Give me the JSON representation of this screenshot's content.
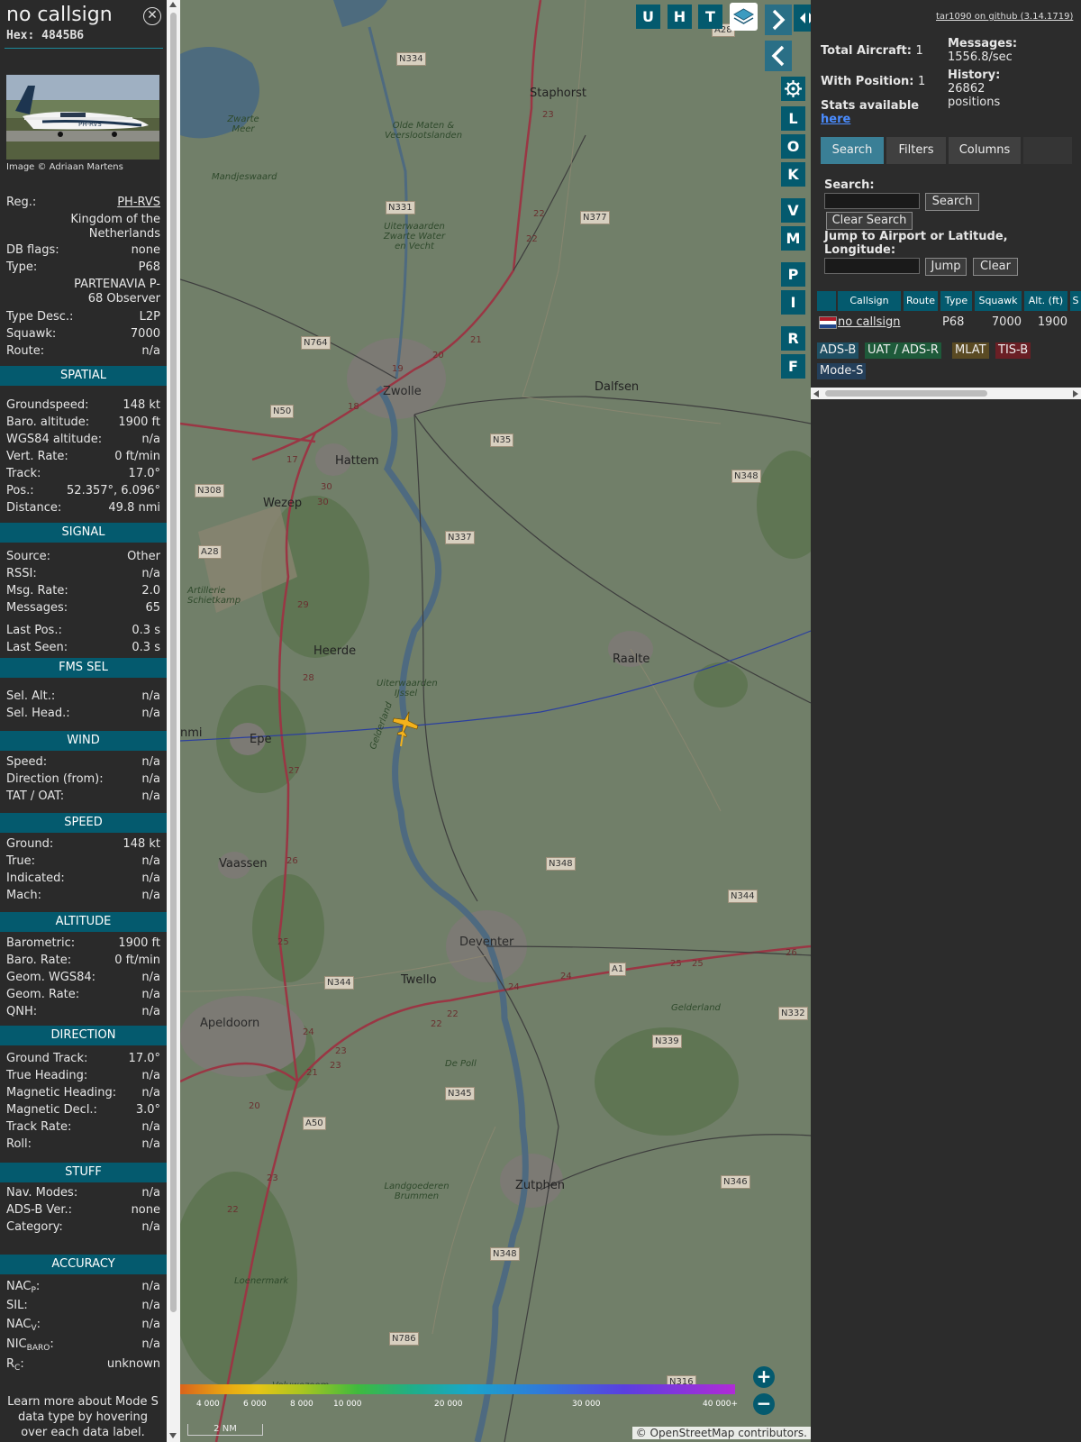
{
  "info": {
    "callsign": "no callsign",
    "hex": "Hex: 4845B6",
    "image_credit": "Image © Adriaan Martens",
    "photo_text": "PH-RVS",
    "details": [
      {
        "k": "Reg.:",
        "v": "PH-RVS"
      },
      {
        "k": "",
        "v": "Kingdom of the Netherlands"
      },
      {
        "k": "DB flags:",
        "v": "none"
      },
      {
        "k": "Type:",
        "v": "P68"
      },
      {
        "k": "",
        "v": "PARTENAVIA P-68 Observer"
      },
      {
        "k": "Type Desc.:",
        "v": "L2P"
      },
      {
        "k": "Squawk:",
        "v": "7000"
      },
      {
        "k": "Route:",
        "v": "n/a"
      }
    ],
    "sections": [
      {
        "title": "SPATIAL",
        "rows": [
          {
            "k": "Groundspeed:",
            "v": "148 kt"
          },
          {
            "k": "Baro. altitude:",
            "v": "1900 ft"
          },
          {
            "k": "WGS84 altitude:",
            "v": "n/a"
          },
          {
            "k": "Vert. Rate:",
            "v": "0 ft/min"
          },
          {
            "k": "Track:",
            "v": "17.0°"
          },
          {
            "k": "Pos.:",
            "v": "52.357°, 6.096°"
          },
          {
            "k": "Distance:",
            "v": "49.8 nmi"
          }
        ]
      },
      {
        "title": "SIGNAL",
        "rows": [
          {
            "k": "Source:",
            "v": "Other"
          },
          {
            "k": "RSSI:",
            "v": "n/a"
          },
          {
            "k": "Msg. Rate:",
            "v": "2.0"
          },
          {
            "k": "Messages:",
            "v": "65"
          },
          {
            "k": "Last Pos.:",
            "v": "0.3 s"
          },
          {
            "k": "Last Seen:",
            "v": "0.3 s"
          }
        ]
      },
      {
        "title": "FMS SEL",
        "rows": [
          {
            "k": "Sel. Alt.:",
            "v": "n/a"
          },
          {
            "k": "Sel. Head.:",
            "v": "n/a"
          }
        ]
      },
      {
        "title": "WIND",
        "rows": [
          {
            "k": "Speed:",
            "v": "n/a"
          },
          {
            "k": "Direction (from):",
            "v": "n/a"
          },
          {
            "k": "TAT / OAT:",
            "v": "n/a"
          }
        ]
      },
      {
        "title": "SPEED",
        "rows": [
          {
            "k": "Ground:",
            "v": "148 kt"
          },
          {
            "k": "True:",
            "v": "n/a"
          },
          {
            "k": "Indicated:",
            "v": "n/a"
          },
          {
            "k": "Mach:",
            "v": "n/a"
          }
        ]
      },
      {
        "title": "ALTITUDE",
        "rows": [
          {
            "k": "Barometric:",
            "v": "1900 ft"
          },
          {
            "k": "Baro. Rate:",
            "v": "0 ft/min"
          },
          {
            "k": "Geom. WGS84:",
            "v": "n/a"
          },
          {
            "k": "Geom. Rate:",
            "v": "n/a"
          },
          {
            "k": "QNH:",
            "v": "n/a"
          }
        ]
      },
      {
        "title": "DIRECTION",
        "rows": [
          {
            "k": "Ground Track:",
            "v": "17.0°"
          },
          {
            "k": "True Heading:",
            "v": "n/a"
          },
          {
            "k": "Magnetic Heading:",
            "v": "n/a"
          },
          {
            "k": "Magnetic Decl.:",
            "v": "3.0°"
          },
          {
            "k": "Track Rate:",
            "v": "n/a"
          },
          {
            "k": "Roll:",
            "v": "n/a"
          }
        ]
      },
      {
        "title": "STUFF",
        "rows": [
          {
            "k": "Nav. Modes:",
            "v": "n/a"
          },
          {
            "k": "ADS-B Ver.:",
            "v": "none"
          },
          {
            "k": "Category:",
            "v": "n/a"
          }
        ]
      },
      {
        "title": "ACCURACY",
        "rows": [
          {
            "k": "NAC",
            "sub": "P",
            "v": "n/a"
          },
          {
            "k": "SIL:",
            "v": "n/a"
          },
          {
            "k": "NAC",
            "sub": "V",
            "v": "n/a"
          },
          {
            "k": "NIC",
            "sub": "BARO",
            "v": "n/a"
          },
          {
            "k": "R",
            "sub": "C",
            "v": "unknown"
          }
        ]
      }
    ],
    "footer": "Learn more about Mode S data type by hovering over each data label."
  },
  "map": {
    "buttons_top": [
      "U",
      "H",
      "T"
    ],
    "side_buttons": [
      "L",
      "O",
      "K",
      "V",
      "M",
      "P",
      "I",
      "R",
      "F"
    ],
    "places": [
      {
        "name": "Staphorst",
        "cls": "city"
      },
      {
        "name": "Zwolle",
        "cls": "big"
      },
      {
        "name": "Dalfsen",
        "cls": "city"
      },
      {
        "name": "Hattem",
        "cls": "city"
      },
      {
        "name": "Wezep",
        "cls": "city"
      },
      {
        "name": "Heerde",
        "cls": "city"
      },
      {
        "name": "Raalte",
        "cls": "city"
      },
      {
        "name": "Epe",
        "cls": "city"
      },
      {
        "name": "Vaassen",
        "cls": "city"
      },
      {
        "name": "Deventer",
        "cls": "big"
      },
      {
        "name": "Twello",
        "cls": "city"
      },
      {
        "name": "Apeldoorn",
        "cls": "big"
      },
      {
        "name": "Zutphen",
        "cls": "city"
      },
      {
        "name": "Mandjeswaard",
        "cls": "it"
      },
      {
        "name": "Zwarte Meer",
        "cls": "it"
      },
      {
        "name": "Olde Maten & Veerslootslanden",
        "cls": "it"
      },
      {
        "name": "Uiterwaarden Zwarte Water en Vecht",
        "cls": "it"
      },
      {
        "name": "Artillerie Schietkamp",
        "cls": "it"
      },
      {
        "name": "Uiterwaarden IJssel",
        "cls": "it"
      },
      {
        "name": "De Poll",
        "cls": "it"
      },
      {
        "name": "Landgoederen Brummen",
        "cls": "it"
      },
      {
        "name": "Loenermark",
        "cls": "it"
      },
      {
        "name": "Veluwezoom",
        "cls": "it"
      },
      {
        "name": "Gelderland",
        "cls": "it"
      },
      {
        "name": "Gelderland",
        "cls": "it"
      },
      {
        "name": "nmi",
        "cls": "city"
      }
    ],
    "shields": [
      "N334",
      "A28",
      "N331",
      "N377",
      "N764",
      "N50",
      "N35",
      "N348",
      "N308",
      "N337",
      "A28",
      "N348",
      "N344",
      "A1",
      "N332",
      "N344",
      "N339",
      "N345",
      "A50",
      "N346",
      "N348",
      "N786",
      "N316"
    ],
    "road_numbers": [
      "23",
      "22",
      "22",
      "21",
      "20",
      "19",
      "18",
      "17",
      "30",
      "30",
      "29",
      "28",
      "27",
      "26",
      "25",
      "24",
      "23",
      "23",
      "22",
      "22",
      "21",
      "20",
      "23",
      "22",
      "24",
      "25",
      "25",
      "26",
      "24"
    ],
    "alt_scale": [
      "4 000",
      "6 000",
      "8 000",
      "10 000",
      "20 000",
      "30 000",
      "40 000+"
    ],
    "scale": "2 NM",
    "attribution": "© OpenStreetMap contributors."
  },
  "panel": {
    "github": "tar1090 on github (3.14.1719)",
    "total_label": "Total Aircraft:",
    "total_value": "1",
    "pos_label": "With Position:",
    "pos_value": "1",
    "stats_label": "Stats available",
    "stats_link": "here",
    "msg_label": "Messages:",
    "msg_value": "1556.8/sec",
    "hist_label": "History:",
    "hist_value": "26862 positions",
    "tabs": [
      "Search",
      "Filters",
      "Columns"
    ],
    "search_label": "Search:",
    "search_btn": "Search",
    "clear_search": "Clear Search",
    "jump_label": "Jump to Airport or Latitude, Longitude:",
    "jump_btn": "Jump",
    "clear_btn": "Clear",
    "columns": [
      "Callsign",
      "Route",
      "Type",
      "Squawk",
      "Alt. (ft)",
      "S"
    ],
    "row": {
      "callsign": "no callsign",
      "route": "",
      "type": "P68",
      "squawk": "7000",
      "alt": "1900"
    },
    "badges": [
      {
        "label": "ADS-B",
        "color": "#1f4f63"
      },
      {
        "label": "UAT / ADS-R",
        "color": "#1e5a3a"
      },
      {
        "label": "MLAT",
        "color": "#5a4a23"
      },
      {
        "label": "TIS-B",
        "color": "#6a1f25"
      },
      {
        "label": "Mode-S",
        "color": "#243f5a"
      }
    ]
  }
}
